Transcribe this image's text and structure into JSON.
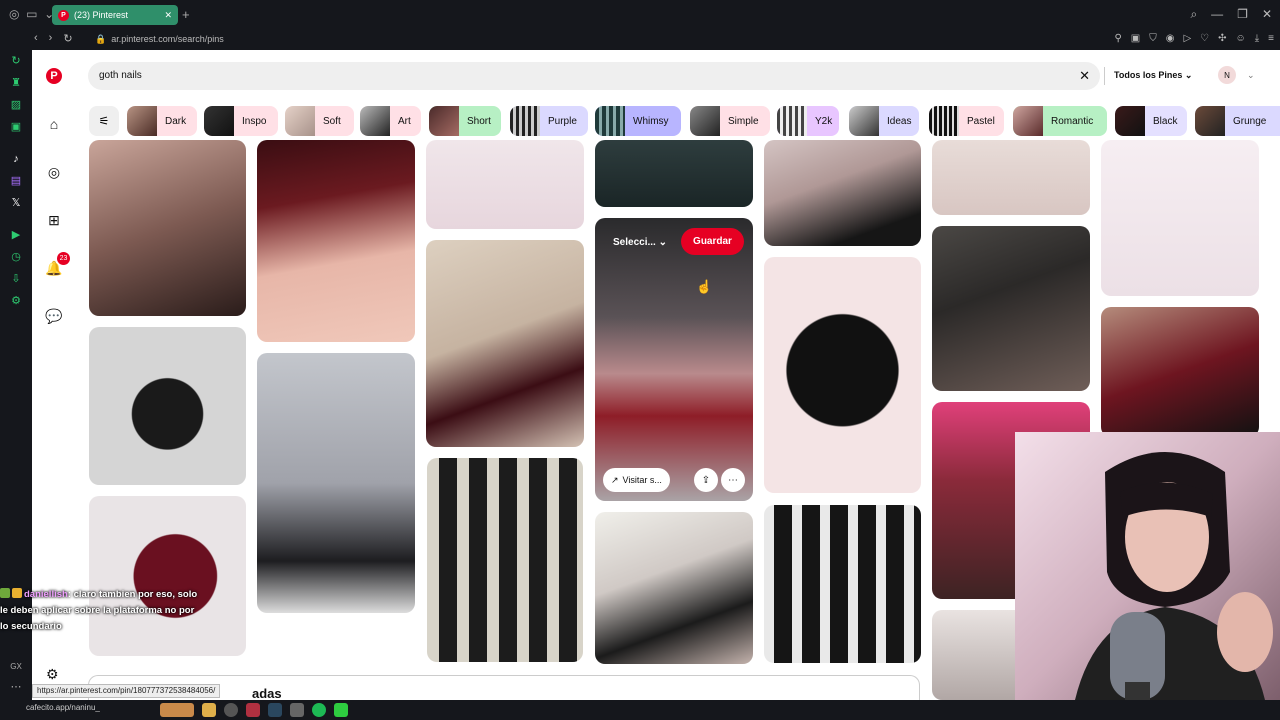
{
  "browser": {
    "tab_title": "(23) Pinterest",
    "favicon_letter": "P",
    "url": "ar.pinterest.com/search/pins"
  },
  "pinterest": {
    "notification_count": "23",
    "search_query": "goth nails",
    "scope": "Todos los Pines",
    "avatar_initial": "N",
    "chips": [
      "Dark",
      "Inspo",
      "Soft",
      "Art",
      "Short",
      "Purple",
      "Whimsy",
      "Simple",
      "Y2k",
      "Ideas",
      "Pastel",
      "Romantic",
      "Black",
      "Grunge"
    ],
    "hover_pin": {
      "select_label": "Selecci...",
      "save_label": "Guardar",
      "visit_label": "Visitar s..."
    },
    "related_title": "adas",
    "status_url": "https://ar.pinterest.com/pin/180777372538484056/"
  },
  "taskbar": {
    "text": "cafecito.app/naninu_"
  },
  "chat": {
    "username": "daniellish",
    "message": ": claro tambien por eso, solo le deben aplicar sobre la plataforma no por lo secundario"
  },
  "colors": {
    "pinterest_red": "#e60023",
    "tab_green": "#2f8f6a",
    "chrome_bg": "#15171c"
  }
}
